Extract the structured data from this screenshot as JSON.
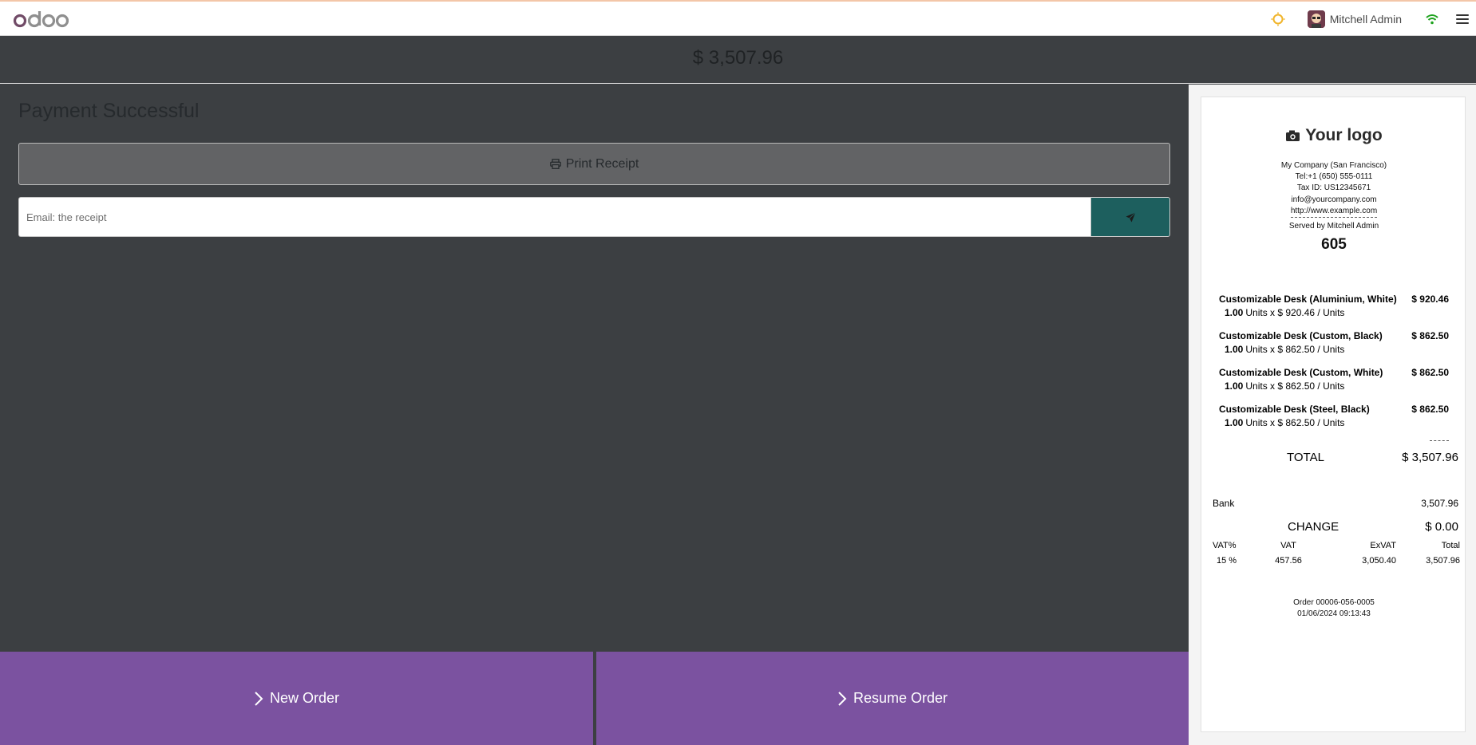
{
  "navbar": {
    "user_name": "Mitchell Admin",
    "icons": [
      "odoo-logo",
      "sun-icon",
      "avatar",
      "wifi-icon",
      "menu-icon"
    ],
    "accent_color": "#f0b429",
    "wifi_color": "#1fa31f"
  },
  "header": {
    "amount": "$ 3,507.96"
  },
  "main": {
    "title": "Payment Successful",
    "print_label": "Print Receipt",
    "email_placeholder": "Email: the receipt"
  },
  "actions": {
    "new_order": "New Order",
    "resume_order": "Resume Order",
    "color": "#7b52a0"
  },
  "receipt": {
    "logo_text": "Your logo",
    "company": "My Company (San Francisco)",
    "tel": "Tel:+1 (650) 555-0111",
    "tax_id": "Tax ID: US12345671",
    "email": "info@yourcompany.com",
    "website": "http://www.example.com",
    "served_by": "Served by Mitchell Admin",
    "number": "605",
    "lines": [
      {
        "name": "Customizable Desk (Aluminium, White)",
        "price": "$ 920.46",
        "qty": "1.00",
        "detail": "Units x $ 920.46 / Units"
      },
      {
        "name": "Customizable Desk (Custom, Black)",
        "price": "$ 862.50",
        "qty": "1.00",
        "detail": "Units x $ 862.50 / Units"
      },
      {
        "name": "Customizable Desk (Custom, White)",
        "price": "$ 862.50",
        "qty": "1.00",
        "detail": "Units x $ 862.50 / Units"
      },
      {
        "name": "Customizable Desk (Steel, Black)",
        "price": "$ 862.50",
        "qty": "1.00",
        "detail": "Units x $ 862.50 / Units"
      }
    ],
    "total_label": "TOTAL",
    "total_value": "$ 3,507.96",
    "bank_label": "Bank",
    "bank_value": "3,507.96",
    "change_label": "CHANGE",
    "change_value": "$ 0.00",
    "vat_headers": [
      "VAT%",
      "VAT",
      "ExVAT",
      "Total"
    ],
    "vat_row": [
      "15 %",
      "457.56",
      "3,050.40",
      "3,507.96"
    ],
    "order_ref": "Order 00006-056-0005",
    "order_date": "01/06/2024 09:13:43"
  }
}
